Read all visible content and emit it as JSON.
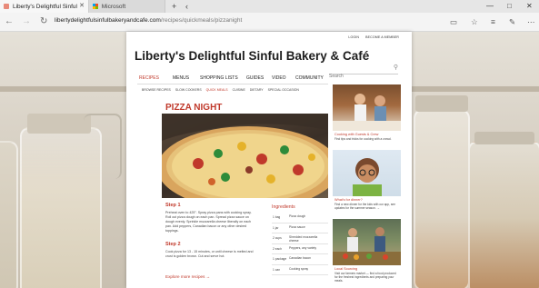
{
  "browser": {
    "tabs": [
      {
        "title": "Liberty's Delightful Sinful",
        "active": true
      },
      {
        "title": "Microsoft",
        "active": false
      }
    ],
    "new_tab_symbol": "+",
    "tab_menu_symbol": "‹",
    "window_controls": {
      "minimize": "—",
      "maximize": "□",
      "close": "✕"
    },
    "nav": {
      "back": "←",
      "forward": "→",
      "refresh": "↻"
    },
    "address": {
      "domain": "libertydelightfulsinfulbakeryandcafe.com",
      "path": "/recipes/quickmeals/pizzanight"
    },
    "right_icons": [
      "reading-view-icon",
      "favorite-star-icon",
      "hub-icon",
      "web-note-icon",
      "share-icon",
      "more-icon"
    ]
  },
  "site": {
    "top_links": [
      "LOGIN",
      "BECOME A MEMBER"
    ],
    "title": "Liberty's Delightful Sinful Bakery & Café",
    "search_placeholder": "Search",
    "main_nav": [
      "RECIPES",
      "MENUS",
      "SHOPPING LISTS",
      "GUIDES",
      "VIDEO",
      "COMMUNITY"
    ],
    "active_main_nav": "RECIPES",
    "sub_nav": [
      "BROWSE RECIPES",
      "SLOW COOKERS",
      "QUICK MEALS",
      "CUISINE",
      "DIETARY",
      "SPECIAL OCCASION"
    ],
    "active_sub_nav": "QUICK MEALS"
  },
  "article": {
    "title": "PIZZA NIGHT",
    "steps": [
      {
        "heading": "Step 1",
        "text": "Preheat oven to 425°. Spray pizza pans with cooking spray. Roll out pizza dough on each pan. Spread pizza sauce on dough evenly. Sprinkle mozzarella cheese liberally on each pan. Add peppers, Canadian bacon or any other desired toppings."
      },
      {
        "heading": "Step 2",
        "text": "Cook pizza for 13 - 15 minutes, or until cheese is melted and crust is golden brown. Cut and serve hot."
      }
    ],
    "explore_link": "Explore more recipes →",
    "ingredients_heading": "Ingredients",
    "ingredients": [
      {
        "qty": "1 bag",
        "name": "Pizza dough"
      },
      {
        "qty": "1 jar",
        "name": "Pizza sauce"
      },
      {
        "qty": "2 cups",
        "name": "Shredded mozzarella cheese"
      },
      {
        "qty": "2 each",
        "name": "Peppers, any variety"
      },
      {
        "qty": "1 package",
        "name": "Canadian bacon"
      },
      {
        "qty": "1 can",
        "name": "Cooking spray"
      }
    ]
  },
  "sidebar": [
    {
      "title": "Cooking with Guests & Crew",
      "text": "Find tips and tricks for cooking with a crowd."
    },
    {
      "title": "What's for dinner?",
      "text": "Find a new dinner for the kids with our app, see updates for the summer season. →"
    },
    {
      "title": "Local Sourcing",
      "text": "Visit our farmers market — find a food produced for the freshest ingredients and preparing your meals."
    }
  ],
  "colors": {
    "accent": "#c0392b",
    "page_bg": "#ffffff",
    "chrome_bg": "#f4f4f4"
  }
}
